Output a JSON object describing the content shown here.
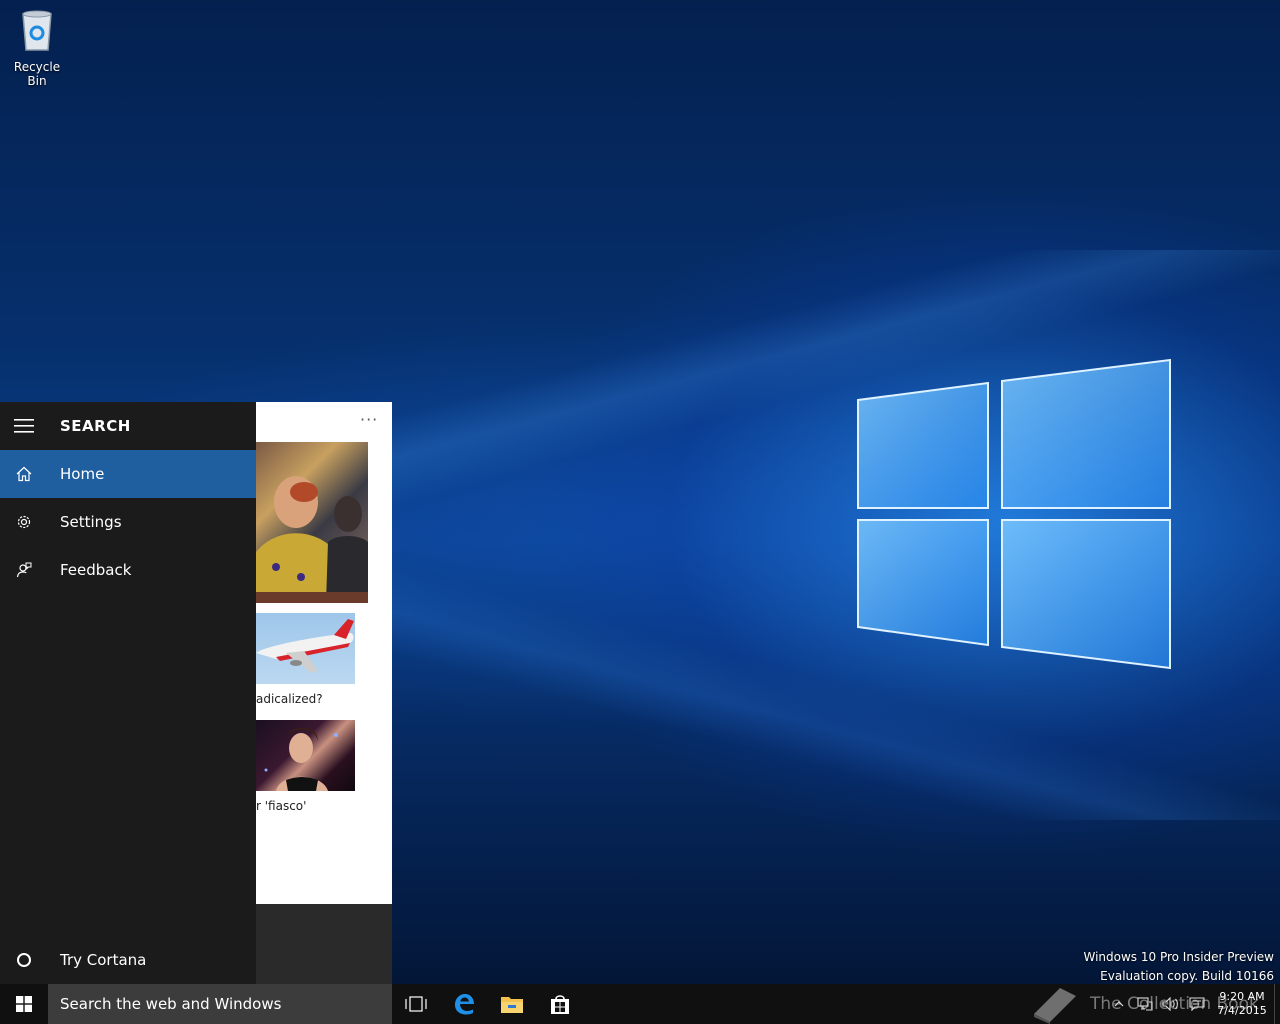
{
  "desktop": {
    "icons": [
      {
        "label": "Recycle Bin",
        "icon": "recycle-bin-icon"
      }
    ],
    "watermark": {
      "line1": "Windows 10 Pro Insider Preview",
      "line2": "Evaluation copy. Build 10166"
    }
  },
  "search_panel": {
    "title": "SEARCH",
    "nav_items": [
      {
        "label": "Home",
        "icon": "home-icon",
        "active": true
      },
      {
        "label": "Settings",
        "icon": "gear-icon",
        "active": false
      },
      {
        "label": "Feedback",
        "icon": "feedback-icon",
        "active": false
      }
    ],
    "bottom_item": {
      "label": "Try Cortana",
      "icon": "circle-icon"
    },
    "content": {
      "more": "···",
      "captions": [
        "adicalized?",
        "r 'fiasco'"
      ]
    }
  },
  "taskbar": {
    "search_placeholder": "Search the web and Windows",
    "pinned": [
      "task-view-icon",
      "edge-icon",
      "file-explorer-icon",
      "store-icon"
    ],
    "clock": {
      "time": "9:20 AM",
      "date": "7/4/2015"
    },
    "overlay_text": "The Collection Book"
  },
  "colors": {
    "accent": "#1f5fa0",
    "panel": "#1b1b1b",
    "taskbar": "#101010",
    "search_box": "#3c3c3c"
  }
}
